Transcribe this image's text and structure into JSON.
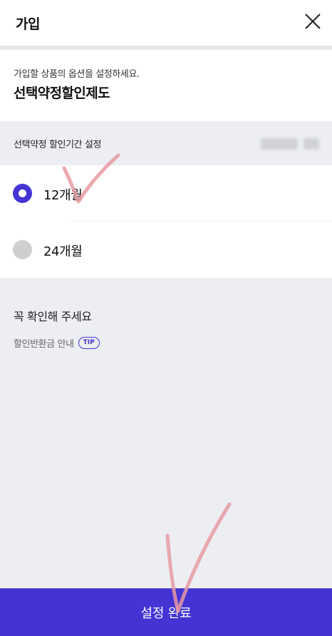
{
  "header": {
    "title": "가입",
    "close_icon": "close-icon"
  },
  "intro": {
    "subtitle": "가입할 상품의 옵션을 설정하세요.",
    "product_name": "선택약정할인제도"
  },
  "period": {
    "label": "선택약정 할인기간 설정"
  },
  "options": [
    {
      "label": "12개월",
      "selected": true
    },
    {
      "label": "24개월",
      "selected": false
    }
  ],
  "notice": {
    "title": "꼭 확인해 주세요",
    "refund_label": "할인반환금 안내",
    "tip_badge": "TIP"
  },
  "footer": {
    "confirm_label": "설정 완료"
  },
  "colors": {
    "accent": "#4434d4",
    "radio_off": "#cfcfd1",
    "background": "#eceef2",
    "annotation": "#e89aa2"
  }
}
